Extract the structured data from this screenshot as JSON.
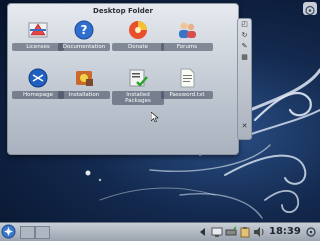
{
  "folder": {
    "title": "Desktop Folder",
    "items": [
      {
        "label": "Licenses",
        "icon": "licenses-icon"
      },
      {
        "label": "Documentation",
        "icon": "help-icon"
      },
      {
        "label": "Donate",
        "icon": "donate-icon"
      },
      {
        "label": "Forums",
        "icon": "forums-icon"
      },
      {
        "label": "Homepage",
        "icon": "homepage-icon"
      },
      {
        "label": "Installation",
        "icon": "installation-icon"
      },
      {
        "label": "Installed Packages",
        "icon": "installed-packages-icon"
      },
      {
        "label": "Password.txt",
        "icon": "text-file-icon"
      }
    ]
  },
  "panel": {
    "clock": "18:39"
  },
  "colors": {
    "desktop_bg": "#13294e",
    "panel_bg": "#b4bbc6",
    "folder_bg": "#dde2e8"
  }
}
